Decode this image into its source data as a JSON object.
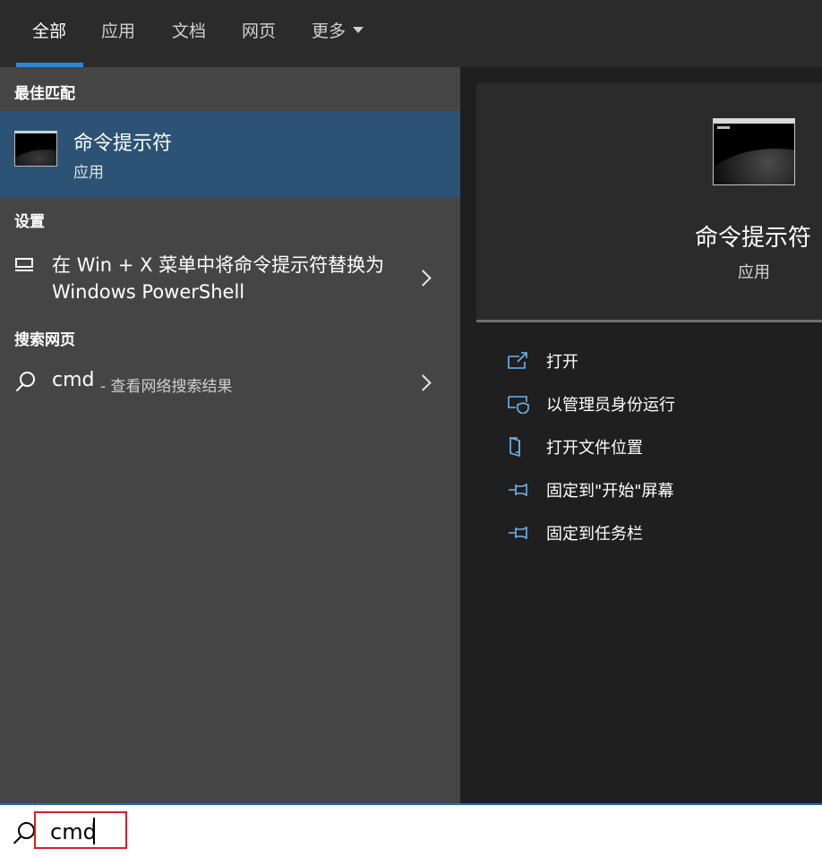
{
  "tabs": [
    {
      "label": "全部",
      "active": true
    },
    {
      "label": "应用",
      "active": false
    },
    {
      "label": "文档",
      "active": false
    },
    {
      "label": "网页",
      "active": false
    },
    {
      "label": "更多",
      "active": false,
      "dropdown": true
    }
  ],
  "colors": {
    "accent": "#2f86d4",
    "selected_bg": "#2c5375",
    "highlight_border": "#d0202a"
  },
  "left": {
    "best_match_title": "最佳匹配",
    "best_match": {
      "name": "命令提示符",
      "type": "应用",
      "icon": "command-prompt-icon"
    },
    "settings_title": "设置",
    "setting_item": {
      "text": "在 Win + X 菜单中将命令提示符替换为 Windows PowerShell",
      "icon": "monitor-icon"
    },
    "web_title": "搜索网页",
    "web_item": {
      "query": "cmd",
      "hint": "- 查看网络搜索结果",
      "icon": "search-icon"
    }
  },
  "preview": {
    "title": "命令提示符",
    "subtitle": "应用",
    "actions": [
      {
        "label": "打开",
        "icon": "open-icon"
      },
      {
        "label": "以管理员身份运行",
        "icon": "admin-shield-icon"
      },
      {
        "label": "打开文件位置",
        "icon": "file-location-icon"
      },
      {
        "label": "固定到\"开始\"屏幕",
        "icon": "pin-icon"
      },
      {
        "label": "固定到任务栏",
        "icon": "pin-icon"
      }
    ]
  },
  "search": {
    "value": "cmd"
  }
}
